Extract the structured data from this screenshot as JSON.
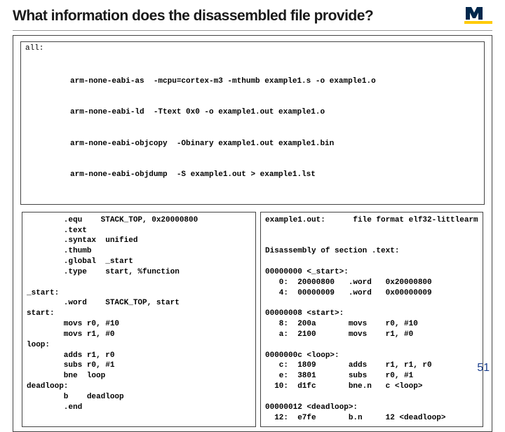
{
  "title": "What information does the disassembled file provide?",
  "page": "51",
  "topbox": {
    "label": "all:",
    "lines": [
      "arm-none-eabi-as  -mcpu=cortex-m3 -mthumb example1.s -o example1.o",
      "arm-none-eabi-ld  -Ttext 0x0 -o example1.out example1.o",
      "arm-none-eabi-objcopy  -Obinary example1.out example1.bin",
      "arm-none-eabi-objdump  -S example1.out > example1.lst"
    ]
  },
  "left": "        .equ    STACK_TOP, 0x20000800\n        .text\n        .syntax  unified\n        .thumb\n        .global  _start\n        .type    start, %function\n\n_start:\n        .word    STACK_TOP, start\nstart:\n        movs r0, #10\n        movs r1, #0\nloop:\n        adds r1, r0\n        subs r0, #1\n        bne  loop\ndeadloop:\n        b    deadloop\n        .end",
  "right": "example1.out:      file format elf32-littlearm\n\n\nDisassembly of section .text:\n\n00000000 <_start>:\n   0:  20000800   .word   0x20000800\n   4:  00000009   .word   0x00000009\n\n00000008 <start>:\n   8:  200a       movs    r0, #10\n   a:  2100       movs    r1, #0\n\n0000000c <loop>:\n   c:  1809       adds    r1, r1, r0\n   e:  3801       subs    r0, #1\n  10:  d1fc       bne.n   c <loop>\n\n00000012 <deadloop>:\n  12:  e7fe       b.n     12 <deadloop>"
}
